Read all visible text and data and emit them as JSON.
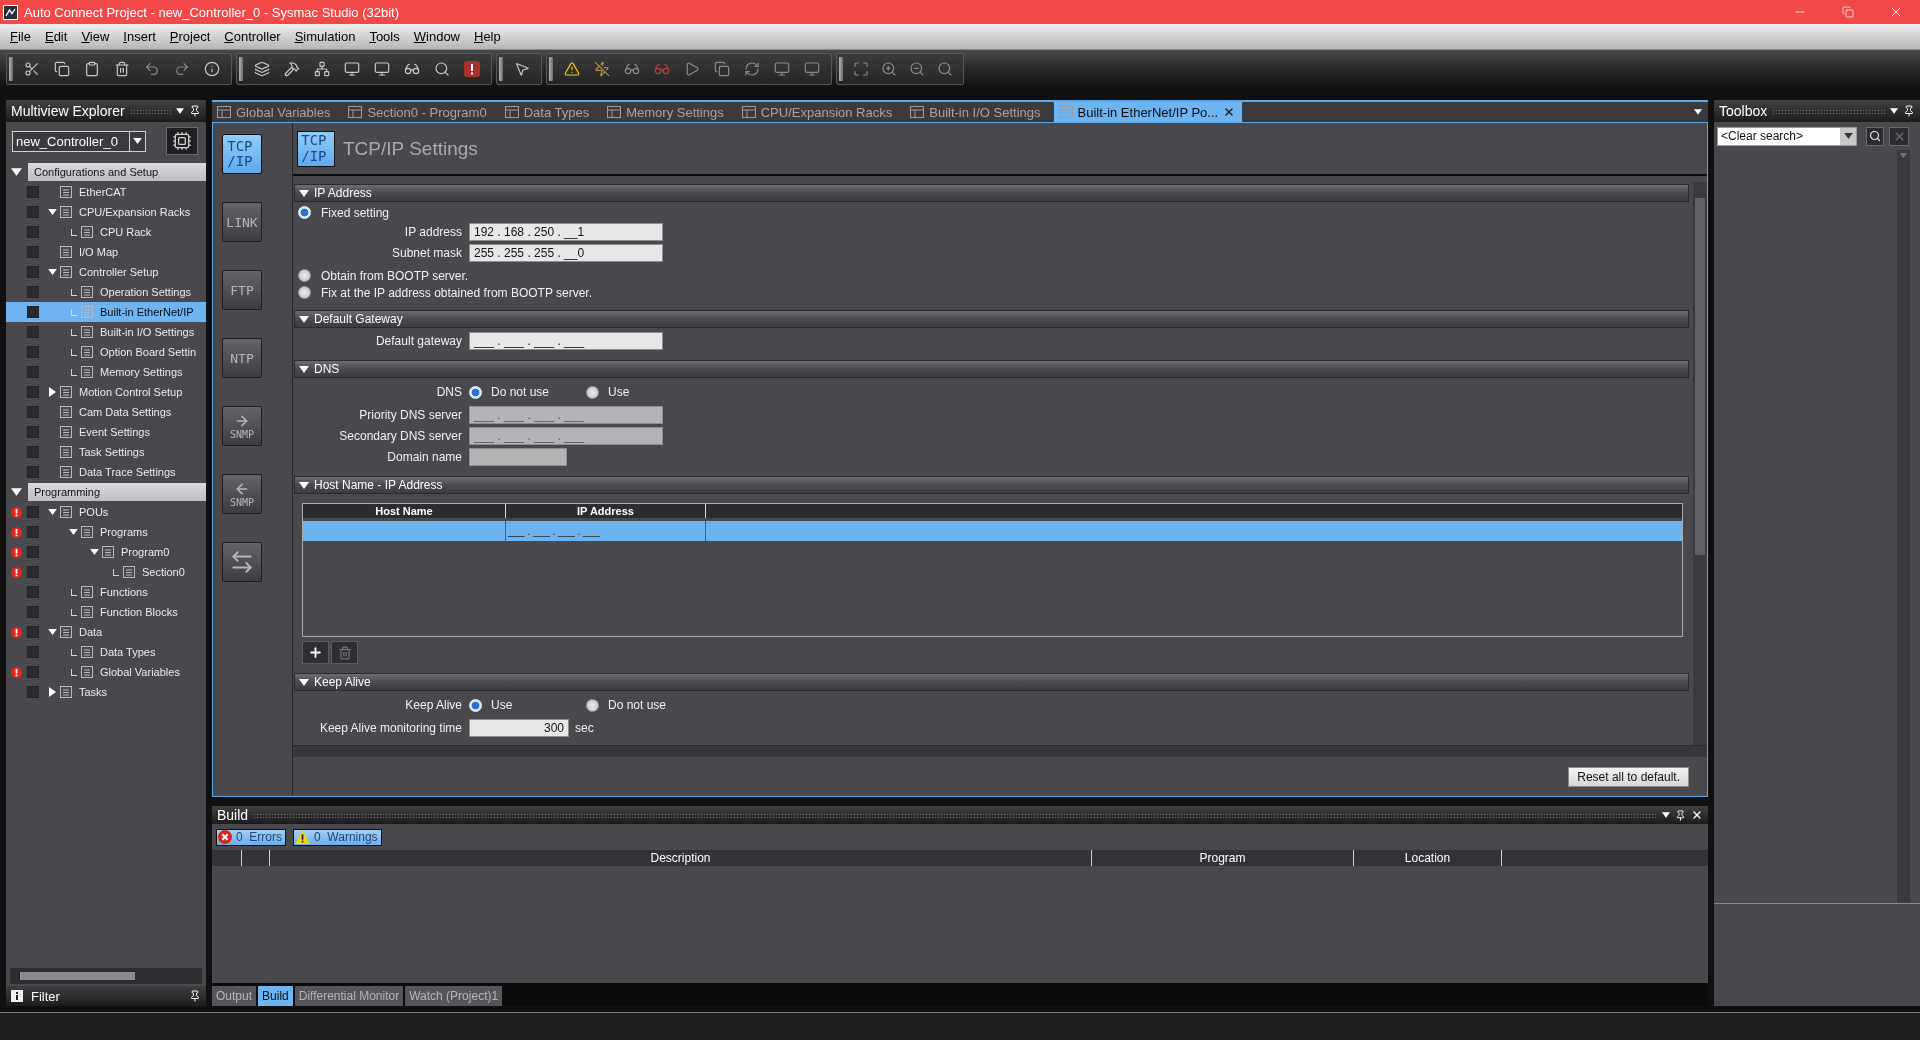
{
  "window": {
    "title": "Auto Connect Project - new_Controller_0 - Sysmac Studio (32bit)"
  },
  "menu": [
    "File",
    "Edit",
    "View",
    "Insert",
    "Project",
    "Controller",
    "Simulation",
    "Tools",
    "Window",
    "Help"
  ],
  "explorer": {
    "title": "Multiview Explorer",
    "controller": "new_Controller_0",
    "tree": [
      {
        "label": "Configurations and Setup",
        "expanded": true,
        "selected": false,
        "children": [
          {
            "label": "EtherCAT",
            "selected": false,
            "error": false
          },
          {
            "label": "CPU/Expansion Racks",
            "expanded": true,
            "selected": false,
            "error": false,
            "children": [
              {
                "label": "CPU Rack",
                "selected": false,
                "error": false
              }
            ]
          },
          {
            "label": "I/O Map",
            "selected": false,
            "error": false
          },
          {
            "label": "Controller Setup",
            "expanded": true,
            "selected": false,
            "error": false,
            "children": [
              {
                "label": "Operation Settings",
                "selected": false,
                "error": false
              },
              {
                "label": "Built-in EtherNet/IP",
                "selected": true,
                "error": false
              },
              {
                "label": "Built-in I/O Settings",
                "selected": false,
                "error": false
              },
              {
                "label": "Option Board Settin",
                "selected": false,
                "error": false
              },
              {
                "label": "Memory Settings",
                "selected": false,
                "error": false
              }
            ]
          },
          {
            "label": "Motion Control Setup",
            "expanded": false,
            "selected": false,
            "error": false
          },
          {
            "label": "Cam Data Settings",
            "selected": false,
            "error": false
          },
          {
            "label": "Event Settings",
            "selected": false,
            "error": false
          },
          {
            "label": "Task Settings",
            "selected": false,
            "error": false
          },
          {
            "label": "Data Trace Settings",
            "selected": false,
            "error": false
          }
        ]
      },
      {
        "label": "Programming",
        "expanded": true,
        "selected": false,
        "children": [
          {
            "label": "POUs",
            "expanded": true,
            "selected": false,
            "error": true,
            "children": [
              {
                "label": "Programs",
                "expanded": true,
                "selected": false,
                "error": true,
                "children": [
                  {
                    "label": "Program0",
                    "expanded": true,
                    "selected": false,
                    "error": true,
                    "children": [
                      {
                        "label": "Section0",
                        "selected": false,
                        "error": true
                      }
                    ]
                  }
                ]
              },
              {
                "label": "Functions",
                "selected": false,
                "error": false
              },
              {
                "label": "Function Blocks",
                "selected": false,
                "error": false
              }
            ]
          },
          {
            "label": "Data",
            "expanded": true,
            "selected": false,
            "error": true,
            "children": [
              {
                "label": "Data Types",
                "selected": false,
                "error": false
              },
              {
                "label": "Global Variables",
                "selected": false,
                "error": true
              }
            ]
          },
          {
            "label": "Tasks",
            "expanded": false,
            "selected": false,
            "error": false
          }
        ]
      }
    ],
    "filter": "Filter"
  },
  "document": {
    "tabs": [
      {
        "label": "Global Variables",
        "selected": false
      },
      {
        "label": "Section0 - Program0",
        "selected": false
      },
      {
        "label": "Data Types",
        "selected": false
      },
      {
        "label": "Memory Settings",
        "selected": false
      },
      {
        "label": "CPU/Expansion Racks",
        "selected": false
      },
      {
        "label": "Built-in I/O Settings",
        "selected": false
      },
      {
        "label": "Built-in EtherNet/IP Po...",
        "selected": true
      }
    ],
    "categories": [
      {
        "kind": "stacked",
        "label": "TCP/IP",
        "selected": true
      },
      {
        "kind": "text",
        "label": "LINK",
        "selected": false
      },
      {
        "kind": "text",
        "label": "FTP",
        "selected": false
      },
      {
        "kind": "text",
        "label": "NTP",
        "selected": false
      },
      {
        "kind": "send",
        "label": "SNMP",
        "selected": false
      },
      {
        "kind": "receive",
        "label": "SNMP",
        "selected": false
      },
      {
        "kind": "graphic",
        "selected": false
      }
    ],
    "heading": {
      "badge": "TCP/IP",
      "title": "TCP/IP Settings"
    },
    "sections": [
      {
        "title": "IP Address",
        "expanded": true,
        "rows": [
          {
            "kind": "radio",
            "label": "Fixed setting",
            "selected": true
          },
          {
            "kind": "ip",
            "label": "IP address",
            "value": "192 . 168 . 250 . __1",
            "disabled": false
          },
          {
            "kind": "ip",
            "label": "Subnet mask",
            "value": "255 . 255 . 255 . __0",
            "disabled": false
          },
          {
            "kind": "radio",
            "label": "Obtain from BOOTP server.",
            "selected": false
          },
          {
            "kind": "radio",
            "label": "Fix at the IP address obtained from BOOTP server.",
            "selected": false
          }
        ]
      },
      {
        "title": "Default Gateway",
        "expanded": true,
        "rows": [
          {
            "kind": "ip",
            "label": "Default gateway",
            "value": "___ . ___ . ___ . ___",
            "disabled": false
          }
        ]
      },
      {
        "title": "DNS",
        "expanded": true,
        "rows": [
          {
            "kind": "choice",
            "label": "DNS",
            "options": [
              {
                "label": "Do not use",
                "selected": true
              },
              {
                "label": "Use",
                "selected": false
              }
            ]
          },
          {
            "kind": "ip",
            "label": "Priority DNS server",
            "value": "___ . ___ . ___ . ___",
            "disabled": true
          },
          {
            "kind": "ip",
            "label": "Secondary DNS server",
            "value": "___ . ___ . ___ . ___",
            "disabled": true
          },
          {
            "kind": "text",
            "label": "Domain name",
            "disabled": true
          }
        ]
      },
      {
        "title": "Host Name - IP Address",
        "expanded": true,
        "rows": [
          {
            "kind": "table",
            "columns": [
              "Host Name",
              "IP Address"
            ],
            "rows": [
              {
                "selected": true,
                "ip_address": "___ . ___ . ___ . ___"
              }
            ],
            "buttons": [
              {
                "kind": "add",
                "disabled": false
              },
              {
                "kind": "delete",
                "disabled": true
              }
            ]
          }
        ]
      },
      {
        "title": "Keep Alive",
        "expanded": true,
        "rows": [
          {
            "kind": "choice",
            "label": "Keep Alive",
            "options": [
              {
                "label": "Use",
                "selected": true
              },
              {
                "label": "Do not use",
                "selected": false
              }
            ]
          },
          {
            "kind": "number",
            "label": "Keep Alive monitoring time",
            "value": "300",
            "unit": "sec",
            "disabled": false
          }
        ]
      }
    ],
    "reset_button": "Reset all to default."
  },
  "build": {
    "title": "Build",
    "filters": [
      {
        "kind": "error",
        "label": "0  Errors",
        "selected": true
      },
      {
        "kind": "warning",
        "label": "0  Warnings",
        "selected": true
      }
    ],
    "columns": [
      "Description",
      "Program",
      "Location"
    ]
  },
  "bottom_tabs": [
    {
      "label": "Output",
      "selected": false
    },
    {
      "label": "Build",
      "selected": true
    },
    {
      "label": "Differential Monitor",
      "selected": false
    },
    {
      "label": "Watch (Project)1",
      "selected": false
    }
  ],
  "toolbox": {
    "title": "Toolbox",
    "search": {
      "value": "<Clear search>"
    },
    "clear_button": {
      "disabled": true
    }
  }
}
